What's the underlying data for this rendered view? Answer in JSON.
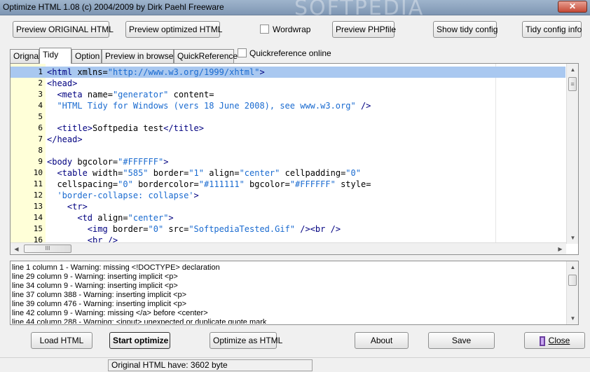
{
  "window": {
    "title": "Optimize HTML 1.08 (c) 2004/2009 by Dirk Paehl Freeware",
    "watermark": "SOFTPEDIA",
    "close_glyph": "✕"
  },
  "toolbar": {
    "preview_original": "Preview ORIGINAL HTML",
    "preview_optimized": "Preview optimized HTML",
    "wordwrap_label": "Wordwrap",
    "wordwrap_checked": false,
    "preview_php": "Preview PHPfile",
    "show_tidy_config": "Show tidy config",
    "tidy_config_info": "Tidy config info"
  },
  "tabs": [
    {
      "label": "Orignal",
      "active": false
    },
    {
      "label": "Tidy",
      "active": true
    },
    {
      "label": "Option",
      "active": false
    },
    {
      "label": "Preview in browser",
      "active": false
    },
    {
      "label": "QuickReference",
      "active": false
    }
  ],
  "quickref_online": {
    "label": "Quickreference online",
    "checked": false
  },
  "editor": {
    "selected_line": 1,
    "lines": [
      {
        "n": "1",
        "parts": [
          [
            "tag",
            "<html "
          ],
          [
            "attr",
            "xmlns="
          ],
          [
            "str",
            "\"http://www.w3.org/1999/xhtml\""
          ],
          [
            "tag",
            ">"
          ]
        ]
      },
      {
        "n": "2",
        "parts": [
          [
            "tag",
            "<head>"
          ]
        ]
      },
      {
        "n": "3",
        "parts": [
          [
            "txt",
            "  "
          ],
          [
            "tag",
            "<meta "
          ],
          [
            "attr",
            "name="
          ],
          [
            "str",
            "\"generator\""
          ],
          [
            "attr",
            " content="
          ]
        ]
      },
      {
        "n": "4",
        "parts": [
          [
            "txt",
            "  "
          ],
          [
            "str",
            "\"HTML Tidy for Windows (vers 18 June 2008), see www.w3.org\""
          ],
          [
            "tag",
            " />"
          ]
        ]
      },
      {
        "n": "5",
        "parts": []
      },
      {
        "n": "6",
        "parts": [
          [
            "txt",
            "  "
          ],
          [
            "tag",
            "<title>"
          ],
          [
            "txt",
            "Softpedia test"
          ],
          [
            "tag",
            "</title>"
          ]
        ]
      },
      {
        "n": "7",
        "parts": [
          [
            "tag",
            "</head>"
          ]
        ]
      },
      {
        "n": "8",
        "parts": []
      },
      {
        "n": "9",
        "parts": [
          [
            "tag",
            "<body "
          ],
          [
            "attr",
            "bgcolor="
          ],
          [
            "str",
            "\"#FFFFFF\""
          ],
          [
            "tag",
            ">"
          ]
        ]
      },
      {
        "n": "10",
        "parts": [
          [
            "txt",
            "  "
          ],
          [
            "tag",
            "<table "
          ],
          [
            "attr",
            "width="
          ],
          [
            "str",
            "\"585\""
          ],
          [
            "attr",
            " border="
          ],
          [
            "str",
            "\"1\""
          ],
          [
            "attr",
            " align="
          ],
          [
            "str",
            "\"center\""
          ],
          [
            "attr",
            " cellpadding="
          ],
          [
            "str",
            "\"0\""
          ]
        ]
      },
      {
        "n": "11",
        "parts": [
          [
            "txt",
            "  "
          ],
          [
            "attr",
            "cellspacing="
          ],
          [
            "str",
            "\"0\""
          ],
          [
            "attr",
            " bordercolor="
          ],
          [
            "str",
            "\"#111111\""
          ],
          [
            "attr",
            " bgcolor="
          ],
          [
            "str",
            "\"#FFFFFF\""
          ],
          [
            "attr",
            " style="
          ]
        ]
      },
      {
        "n": "12",
        "parts": [
          [
            "txt",
            "  "
          ],
          [
            "str",
            "'border-collapse: collapse'"
          ],
          [
            "tag",
            ">"
          ]
        ]
      },
      {
        "n": "13",
        "parts": [
          [
            "txt",
            "    "
          ],
          [
            "tag",
            "<tr>"
          ]
        ]
      },
      {
        "n": "14",
        "parts": [
          [
            "txt",
            "      "
          ],
          [
            "tag",
            "<td "
          ],
          [
            "attr",
            "align="
          ],
          [
            "str",
            "\"center\""
          ],
          [
            "tag",
            ">"
          ]
        ]
      },
      {
        "n": "15",
        "parts": [
          [
            "txt",
            "        "
          ],
          [
            "tag",
            "<img "
          ],
          [
            "attr",
            "border="
          ],
          [
            "str",
            "\"0\""
          ],
          [
            "attr",
            " src="
          ],
          [
            "str",
            "\"SoftpediaTested.Gif\""
          ],
          [
            "tag",
            " /><br />"
          ]
        ]
      },
      {
        "n": "16",
        "parts": [
          [
            "txt",
            "        "
          ],
          [
            "tag",
            "<br />"
          ]
        ]
      }
    ],
    "hscroll_grip": "III",
    "vscroll_grip": "≡"
  },
  "log": {
    "lines": [
      "line 1 column 1 - Warning: missing <!DOCTYPE> declaration",
      "line 29 column 9 - Warning: inserting implicit <p>",
      "line 34 column 9 - Warning: inserting implicit <p>",
      "line 37 column 388 - Warning: inserting implicit <p>",
      "line 39 column 476 - Warning: inserting implicit <p>",
      "line 42 column 9 - Warning: missing </a> before <center>",
      "line 44 column 288 - Warning: <input> unexpected or duplicate quote mark"
    ]
  },
  "bottom": {
    "load_html": "Load HTML",
    "start_optimize": "Start optimize",
    "optimize_as_html": "Optimize as HTML",
    "about": "About",
    "save": "Save",
    "close": "Close"
  },
  "status": {
    "text": "Original HTML have: 3602 byte"
  }
}
